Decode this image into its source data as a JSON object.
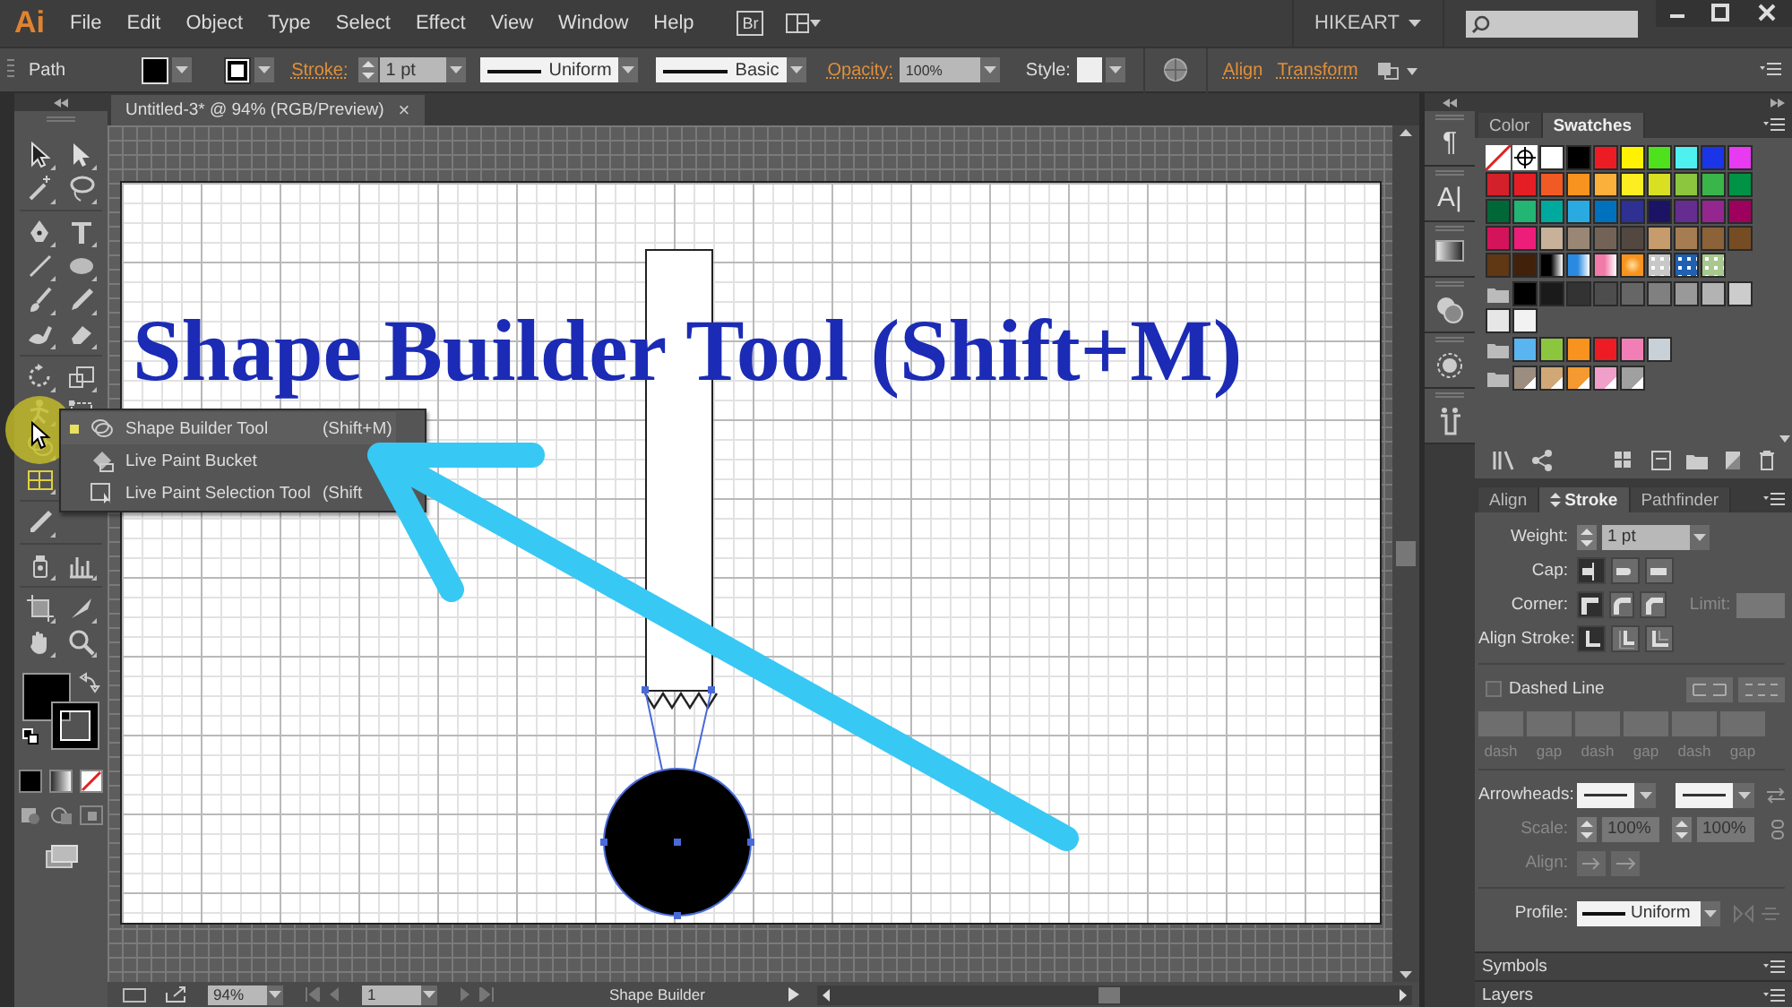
{
  "menu_bar": {
    "logo": "Ai",
    "menus": [
      "File",
      "Edit",
      "Object",
      "Type",
      "Select",
      "Effect",
      "View",
      "Window",
      "Help"
    ],
    "bridge": "Br",
    "workspace": "HIKEART"
  },
  "control_bar": {
    "selection": "Path",
    "stroke_label": "Stroke:",
    "stroke_weight": "1 pt",
    "variable_width": "Uniform",
    "brush": "Basic",
    "opacity_label": "Opacity:",
    "opacity": "100%",
    "style_label": "Style:",
    "align_link": "Align",
    "transform_link": "Transform"
  },
  "document": {
    "tab": "Untitled-3* @ 94% (RGB/Preview)",
    "close": "×",
    "title": "Shape Builder Tool (Shift+M)"
  },
  "flyout": {
    "items": [
      {
        "label": "Shape Builder Tool",
        "shortcut": "(Shift+M)",
        "selected": true
      },
      {
        "label": "Live Paint Bucket",
        "selected": false
      },
      {
        "label": "Live Paint Selection Tool",
        "shortcut": "(Shift",
        "selected": false
      }
    ]
  },
  "dock": [
    "¶",
    "A|"
  ],
  "panels": {
    "tabs": [
      {
        "label": "Color",
        "selected": false
      },
      {
        "label": "Swatches",
        "selected": true
      }
    ],
    "swatches": [
      [
        {
          "kind": "none"
        },
        {
          "kind": "registration"
        },
        {
          "kind": "solid",
          "color": "#ffffff"
        },
        {
          "kind": "solid",
          "color": "#000000"
        },
        {
          "kind": "solid",
          "color": "#ed1c24"
        },
        {
          "kind": "solid",
          "color": "#fff200"
        },
        {
          "kind": "solid",
          "color": "#4fe01e"
        },
        {
          "kind": "solid",
          "color": "#4ff0f0"
        },
        {
          "kind": "solid",
          "color": "#1a35e8"
        },
        {
          "kind": "solid",
          "color": "#e83af0"
        }
      ],
      [
        {
          "kind": "solid",
          "color": "#d4202a"
        },
        {
          "kind": "solid",
          "color": "#e51e25"
        },
        {
          "kind": "solid",
          "color": "#f15a24"
        },
        {
          "kind": "solid",
          "color": "#f7931e"
        },
        {
          "kind": "solid",
          "color": "#fbb03b"
        },
        {
          "kind": "solid",
          "color": "#fcee21"
        },
        {
          "kind": "solid",
          "color": "#d9e021"
        },
        {
          "kind": "solid",
          "color": "#8cc63f"
        },
        {
          "kind": "solid",
          "color": "#39b54a"
        },
        {
          "kind": "solid",
          "color": "#009245"
        }
      ],
      [
        {
          "kind": "solid",
          "color": "#006837"
        },
        {
          "kind": "solid",
          "color": "#22b573"
        },
        {
          "kind": "solid",
          "color": "#00a99d"
        },
        {
          "kind": "solid",
          "color": "#29abe2"
        },
        {
          "kind": "solid",
          "color": "#0071bc"
        },
        {
          "kind": "solid",
          "color": "#2e3192"
        },
        {
          "kind": "solid",
          "color": "#1b1464"
        },
        {
          "kind": "solid",
          "color": "#662d91"
        },
        {
          "kind": "solid",
          "color": "#93278f"
        },
        {
          "kind": "solid",
          "color": "#9e005d"
        }
      ],
      [
        {
          "kind": "solid",
          "color": "#d4145a"
        },
        {
          "kind": "solid",
          "color": "#ed1e79"
        },
        {
          "kind": "solid",
          "color": "#c7b299"
        },
        {
          "kind": "solid",
          "color": "#998675"
        },
        {
          "kind": "solid",
          "color": "#736357"
        },
        {
          "kind": "solid",
          "color": "#534741"
        },
        {
          "kind": "solid",
          "color": "#c69c6d"
        },
        {
          "kind": "solid",
          "color": "#a67c52"
        },
        {
          "kind": "solid",
          "color": "#8c6239"
        },
        {
          "kind": "solid",
          "color": "#754c24"
        }
      ],
      [
        {
          "kind": "solid",
          "color": "#603813"
        },
        {
          "kind": "solid",
          "color": "#42210b"
        },
        {
          "kind": "gradient",
          "color": "#000000"
        },
        {
          "kind": "gradient",
          "color": "#2a8ae0"
        },
        {
          "kind": "gradient",
          "color": "#f07aa8"
        },
        {
          "kind": "radial",
          "color": "#f7931e"
        },
        {
          "kind": "pattern",
          "color": "#c8c8c8"
        },
        {
          "kind": "pattern",
          "color": "#2060b0"
        },
        {
          "kind": "pattern",
          "color": "#a8c890"
        }
      ],
      [
        {
          "kind": "folder"
        },
        {
          "kind": "solid",
          "color": "#000000"
        },
        {
          "kind": "solid",
          "color": "#1a1a1a"
        },
        {
          "kind": "solid",
          "color": "#333333"
        },
        {
          "kind": "solid",
          "color": "#4d4d4d"
        },
        {
          "kind": "solid",
          "color": "#666666"
        },
        {
          "kind": "solid",
          "color": "#808080"
        },
        {
          "kind": "solid",
          "color": "#999999"
        },
        {
          "kind": "solid",
          "color": "#b3b3b3"
        },
        {
          "kind": "solid",
          "color": "#cccccc"
        }
      ],
      [
        {
          "kind": "solid",
          "color": "#e6e6e6"
        },
        {
          "kind": "solid",
          "color": "#f2f2f2"
        }
      ],
      [
        {
          "kind": "folder"
        },
        {
          "kind": "solid",
          "color": "#5ab4f0"
        },
        {
          "kind": "solid",
          "color": "#8cc63f"
        },
        {
          "kind": "solid",
          "color": "#f7931e"
        },
        {
          "kind": "solid",
          "color": "#ed1c24"
        },
        {
          "kind": "solid",
          "color": "#f17fb5"
        },
        {
          "kind": "solid",
          "color": "#c8d0d8"
        }
      ],
      [
        {
          "kind": "folder"
        },
        {
          "kind": "spot",
          "color": "#9b8d80"
        },
        {
          "kind": "spot",
          "color": "#d0a878"
        },
        {
          "kind": "spot",
          "color": "#f59a30"
        },
        {
          "kind": "spot",
          "color": "#f0a0c8"
        },
        {
          "kind": "spot",
          "color": "#a0a0a0"
        }
      ]
    ],
    "stroke_tabs": [
      {
        "label": "Align",
        "selected": false
      },
      {
        "label": "Stroke",
        "selected": true
      },
      {
        "label": "Pathfinder",
        "selected": false
      }
    ],
    "stroke": {
      "weight_label": "Weight:",
      "weight": "1 pt",
      "cap_label": "Cap:",
      "caps": [
        {
          "selected": true
        },
        {
          "selected": false
        },
        {
          "selected": false
        }
      ],
      "corner_label": "Corner:",
      "corners": [
        {
          "selected": true
        },
        {
          "selected": false
        },
        {
          "selected": false
        }
      ],
      "limit_label": "Limit:",
      "align_label": "Align Stroke:",
      "aligns": [
        {
          "selected": true
        },
        {
          "selected": false
        },
        {
          "selected": false
        }
      ],
      "dashed": {
        "label": "Dashed Line",
        "checked": false
      },
      "dash_fields": [
        "dash",
        "gap",
        "dash",
        "gap",
        "dash",
        "gap"
      ],
      "arrowheads_label": "Arrowheads:",
      "scale_label": "Scale:",
      "scales": [
        "100%",
        "100%"
      ],
      "arrow_align_label": "Align:",
      "profile_label": "Profile:",
      "profile": "Uniform"
    },
    "collapsed": [
      "Symbols",
      "Layers"
    ]
  },
  "status_bar": {
    "zoom": "94%",
    "artboard": "1",
    "tool": "Shape Builder"
  }
}
